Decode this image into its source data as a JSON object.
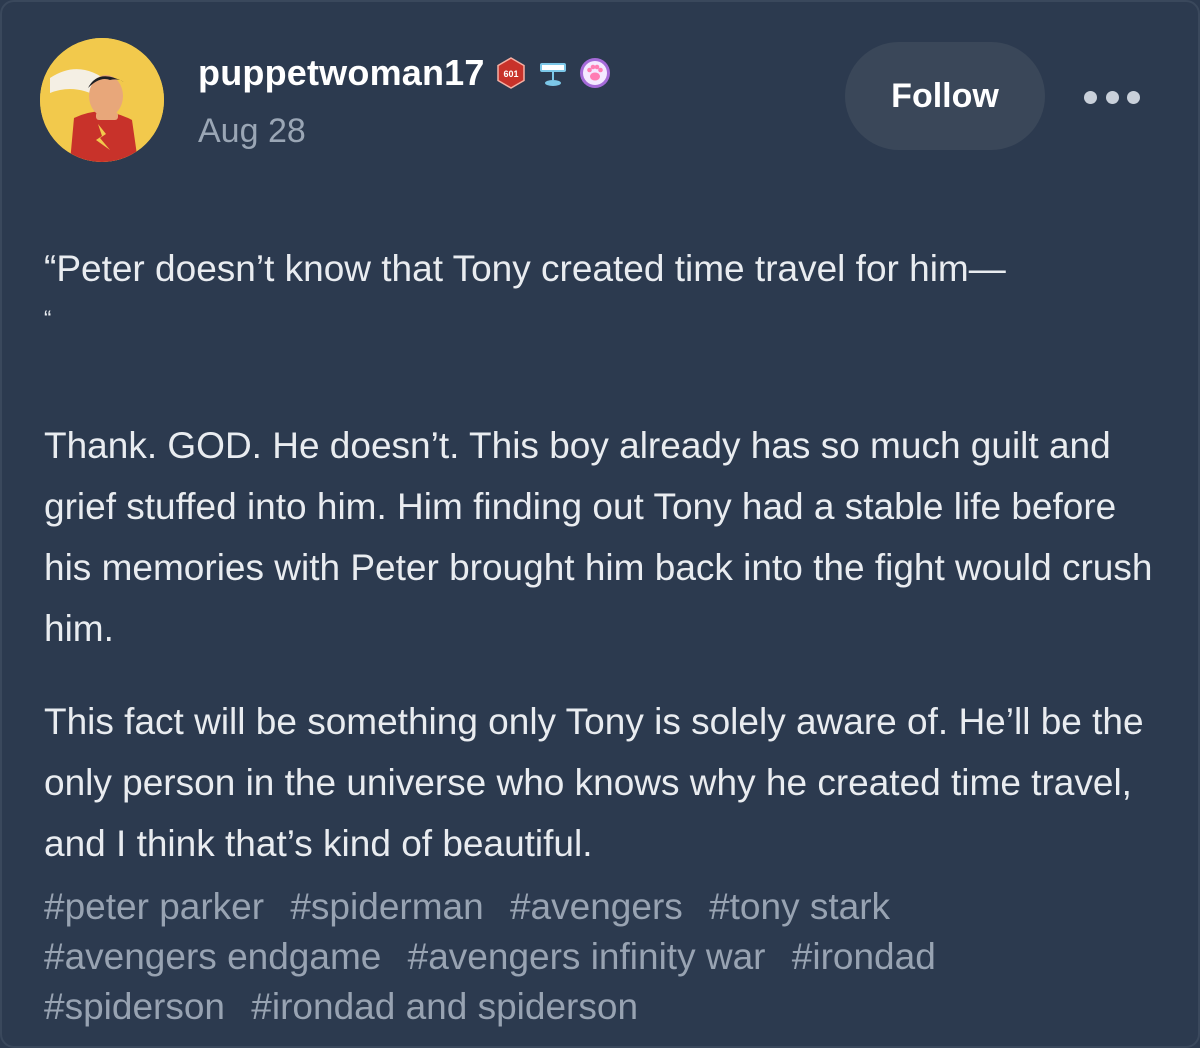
{
  "post": {
    "username": "puppetwoman17",
    "date": "Aug 28",
    "follow_label": "Follow",
    "badges": [
      {
        "name": "badge-601-icon",
        "text": "601"
      },
      {
        "name": "badge-sign-icon",
        "text": ""
      },
      {
        "name": "badge-paw-icon",
        "text": ""
      }
    ],
    "quote": "“Peter doesn’t know that Tony created time travel for him—",
    "quote_mark": "“",
    "paragraph1": "Thank. GOD. He doesn’t. This boy already has so much guilt and grief stuffed into him. Him finding out Tony had a stable life before his memories with Peter brought him back into the fight would crush him.",
    "paragraph2": "This fact will be something only Tony is solely aware of. He’ll be the only person in the universe who knows why he created time travel, and I think that’s kind of beautiful.",
    "tags": [
      "#peter parker",
      "#spiderman",
      "#avengers",
      "#tony stark",
      "#avengers endgame",
      "#avengers infinity war",
      "#irondad",
      "#spiderson",
      "#irondad and spiderson"
    ]
  },
  "colors": {
    "background": "#2c3a4f",
    "text": "#e9ecf0",
    "muted": "#9aa6b5",
    "button": "#3a4759"
  }
}
